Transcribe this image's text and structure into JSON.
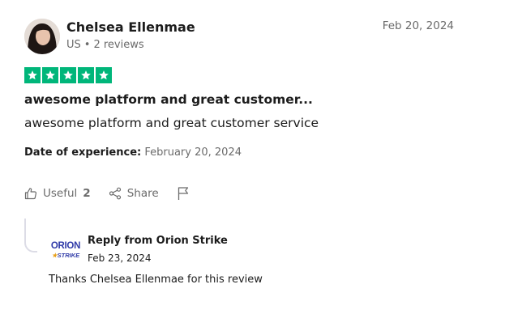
{
  "reviewer": {
    "name": "Chelsea Ellenmae",
    "country": "US",
    "reviews": "2 reviews"
  },
  "review": {
    "date": "Feb 20, 2024",
    "rating": 5,
    "rating_max": 5,
    "star_color": "#00b67a",
    "title": "awesome platform and great customer...",
    "body": "awesome platform and great customer service",
    "experience_label": "Date of experience:",
    "experience_date": "February 20, 2024"
  },
  "actions": {
    "useful_label": "Useful",
    "useful_count": "2",
    "share_label": "Share",
    "icons": [
      "thumbs-up-icon",
      "share-icon",
      "flag-icon"
    ]
  },
  "reply": {
    "logo_text_top": "ORION",
    "logo_text_bottom": "STRIKE",
    "from": "Reply from Orion Strike",
    "date": "Feb 23, 2024",
    "text": "Thanks Chelsea Ellenmae for this review"
  }
}
